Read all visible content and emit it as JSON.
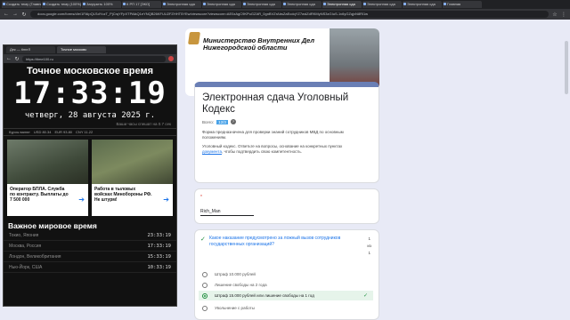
{
  "browser": {
    "tabs": [
      "Создать тему (Главное) – Н.",
      "Создать тему (100%)",
      "Загрузить 100%",
      "К РП 17 [ЭКО]",
      "Электронная сда",
      "Электронная сда",
      "Электронная сда",
      "Электронная сда",
      "Электронная сда",
      "Электронная сда",
      "Электронная сда",
      "Главная"
    ],
    "url": "docs.google.com/forms/d/e/1FAIpQLSdYczT_PjCrqYFpXTPAikQ1eYNQB26KFUU2FZHHT5YEw/viewscore?viewscore=AE0zAgC9KPuGZAR_0gnBVZrAbsZaEcdqYZ7wdZdRKMyNS3zGIuS-1v6yGZqjxN8Rl1w"
  },
  "form": {
    "ministry": "Министерство Внутренних Дел Нижегородской области",
    "title": "Электронная сдача Уголовный Кодекс",
    "email_prefix": "Всего:",
    "email_value": "12/3",
    "description": "Форма предназначена для проверки знаний сотрудников МВД по основным положениям.",
    "description2_a": "Уголовный кодекс. Ответьте на вопросы, основание на конкретных пунктах ",
    "description2_link": "документа",
    "description2_b": ", чтобы подтвердить свою компетентность.",
    "required_mark": "*",
    "name_value": "Rich_Man",
    "question": "Какое наказание предусмотрено за ложный вызов сотрудников государственных организаций?",
    "score_top": "1",
    "score_mid": "из",
    "score_bot": "1",
    "options": [
      "Штраф 10.000 рублей",
      "Лишение свободы на 2 года",
      "Штраф 15.000 рублей или лишение свободы на 1 год",
      "Увольнение с работы"
    ]
  },
  "time_window": {
    "tab1": "Дек — timeЛ",
    "tab2": "Точное московс",
    "url": "https://time100.ru",
    "heading": "Точное московское время",
    "clock": "17:33:19",
    "date": "четверг, 28 августа 2025 г.",
    "note": "Ваши часы спешат на 0.7 сек",
    "rates": [
      "Курсы валют",
      "USD 80.34",
      "EUR 93.80",
      "CNY 11.22"
    ],
    "ads": [
      {
        "text": "Оператор БПЛА. Служба по контракту. Выплаты до 7 500 000",
        "src": "ad"
      },
      {
        "text": "Работа в тыловых войсках Минобороны РФ. Не штурм!",
        "src": "ad"
      }
    ],
    "world_title": "Важное мировое время",
    "cities": [
      {
        "name": "Токио, Япония",
        "time": "23:33:19"
      },
      {
        "name": "Москва, Россия",
        "time": "17:33:19"
      },
      {
        "name": "Лондон, Великобритания",
        "time": "15:33:19"
      },
      {
        "name": "Нью-Йорк, США",
        "time": "10:33:19"
      }
    ]
  }
}
